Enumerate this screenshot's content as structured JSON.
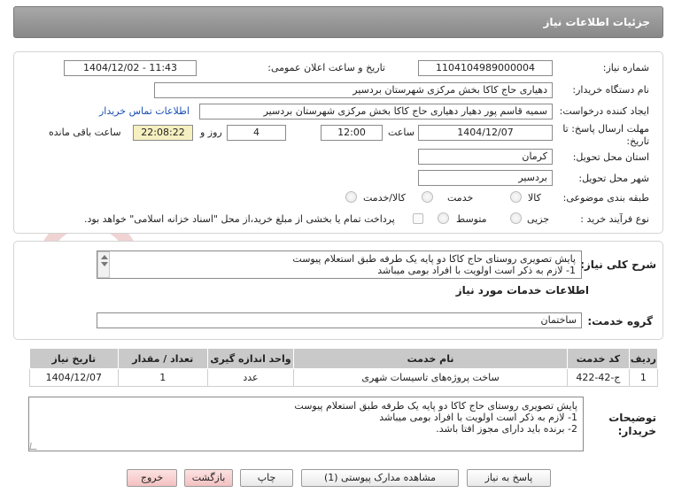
{
  "header": {
    "title": "جزئیات اطلاعات نیاز"
  },
  "fields": {
    "need_number_label": "شماره نیاز:",
    "need_number": "1104104989000004",
    "announce_label": "تاریخ و ساعت اعلان عمومی:",
    "announce_value": "1404/12/02 - 11:43",
    "buyer_org_label": "نام دستگاه خریدار:",
    "buyer_org": "دهیاری حاج کاکا بخش مرکزی شهرستان بردسیر",
    "requester_label": "ایجاد کننده درخواست:",
    "requester": "سمیه قاسم پور دهیار دهیاری حاج کاکا بخش مرکزی شهرستان بردسیر",
    "contact_link": "اطلاعات تماس خریدار",
    "deadline_label_1": "مهلت ارسال پاسخ: تا",
    "deadline_label_2": "تاریخ:",
    "deadline_date": "1404/12/07",
    "time_label": "ساعت",
    "deadline_time": "12:00",
    "days_value": "4",
    "days_label": "روز و",
    "remaining_time": "22:08:22",
    "remaining_label": "ساعت باقی مانده",
    "province_label": "استان محل تحویل:",
    "province": "کرمان",
    "city_label": "شهر محل تحویل:",
    "city": "بردسیر",
    "category_label": "طبقه بندی موضوعی:",
    "category_options": [
      "کالا",
      "خدمت",
      "کالا/خدمت"
    ],
    "process_label": "نوع فرآیند خرید :",
    "process_options": [
      "جزیی",
      "متوسط"
    ],
    "payment_note": "پرداخت تمام یا بخشی از مبلغ خرید،از محل \"اسناد خزانه اسلامی\" خواهد بود."
  },
  "summary": {
    "label": "شرح کلی نیاز:",
    "line1": "پایش تصویری روستای حاج کاکا دو پایه یک طرفه طبق استعلام پیوست",
    "line2": "1- لازم به ذکر است اولویت با افراد بومی میباشد"
  },
  "services": {
    "section_title": "اطلاعات خدمات مورد نیاز",
    "group_label": "گروه خدمت:",
    "group_value": "ساختمان",
    "columns": [
      "ردیف",
      "کد خدمت",
      "نام خدمت",
      "واحد اندازه گیری",
      "تعداد / مقدار",
      "تاریخ نیاز"
    ],
    "rows": [
      [
        "1",
        "ج-42-422",
        "ساخت پروژه‌های تاسیسات شهری",
        "عدد",
        "1",
        "1404/12/07"
      ]
    ]
  },
  "buyer_notes": {
    "label_1": "توضیحات",
    "label_2": "خریدار:",
    "line1": "پایش تصویری روستای حاج کاکا دو پایه یک طرفه طبق استعلام پیوست",
    "line2": "1- لازم به ذکر است اولویت با افراد بومی میباشد",
    "line3": "2- برنده باید دارای مجوز افتا باشد."
  },
  "buttons": {
    "reply": "پاسخ به نیاز",
    "attachments": "مشاهده مدارک پیوستی (1)",
    "print": "چاپ",
    "back": "بازگشت",
    "exit": "خروج"
  },
  "watermark": {
    "text": "AriaTender.net"
  },
  "colors": {
    "header": "#959595",
    "highlight": "#f6f0c0",
    "link": "#1a4fb3",
    "pink_button": "#f3c1c1"
  }
}
